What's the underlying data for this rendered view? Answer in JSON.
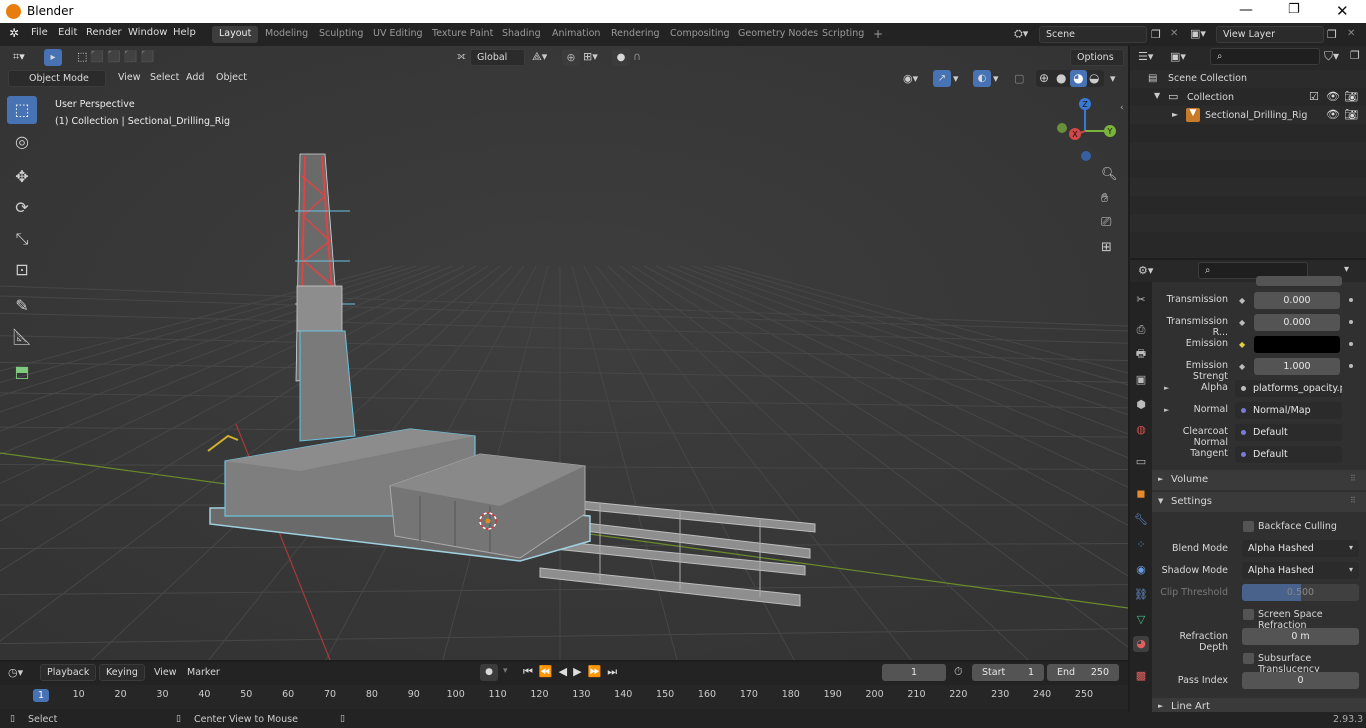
{
  "app": {
    "title": "Blender",
    "version": "2.93.3"
  },
  "menus": [
    "File",
    "Edit",
    "Render",
    "Window",
    "Help"
  ],
  "workspaces": [
    "Layout",
    "Modeling",
    "Sculpting",
    "UV Editing",
    "Texture Paint",
    "Shading",
    "Animation",
    "Rendering",
    "Compositing",
    "Geometry Nodes",
    "Scripting"
  ],
  "active_workspace": "Layout",
  "scene": {
    "name": "Scene",
    "view_layer": "View Layer"
  },
  "viewport": {
    "mode": "Object Mode",
    "menus": [
      "View",
      "Select",
      "Add",
      "Object"
    ],
    "orientation": "Global",
    "options_label": "Options",
    "perspective_label": "User Perspective",
    "collection_label": "(1) Collection | Sectional_Drilling_Rig",
    "axes": {
      "x": "X",
      "y": "Y",
      "z": "Z"
    }
  },
  "outliner": {
    "root": "Scene Collection",
    "collection": "Collection",
    "object": "Sectional_Drilling_Rig"
  },
  "properties": {
    "rows": [
      {
        "label": "Transmission",
        "value": "0.000"
      },
      {
        "label": "Transmission R...",
        "value": "0.000"
      },
      {
        "label": "Emission",
        "value": ""
      },
      {
        "label": "Emission Strengt",
        "value": "1.000"
      },
      {
        "label": "Alpha",
        "value": "platforms_opacity.pn"
      },
      {
        "label": "Normal",
        "value": "Normal/Map"
      },
      {
        "label": "Clearcoat Normal",
        "value": "Default"
      },
      {
        "label": "Tangent",
        "value": "Default"
      }
    ],
    "panels": {
      "volume": "Volume",
      "settings": "Settings",
      "line_art": "Line Art"
    },
    "settings": {
      "backface_culling": "Backface Culling",
      "blend_mode_label": "Blend Mode",
      "blend_mode": "Alpha Hashed",
      "shadow_mode_label": "Shadow Mode",
      "shadow_mode": "Alpha Hashed",
      "clip_threshold_label": "Clip Threshold",
      "clip_threshold": "0.500",
      "ssr": "Screen Space Refraction",
      "refraction_depth_label": "Refraction Depth",
      "refraction_depth": "0 m",
      "subsurface": "Subsurface Translucency",
      "pass_index_label": "Pass Index",
      "pass_index": "0"
    },
    "colors": {
      "emission": "#000000",
      "clip_fill": "#5680c2"
    }
  },
  "timeline": {
    "menus": [
      "Playback",
      "Keying",
      "View",
      "Marker"
    ],
    "current_frame": "1",
    "start_label": "Start",
    "start": "1",
    "end_label": "End",
    "end": "250",
    "ticks": [
      "1",
      "10",
      "20",
      "30",
      "40",
      "50",
      "60",
      "70",
      "80",
      "90",
      "100",
      "110",
      "120",
      "130",
      "140",
      "150",
      "160",
      "170",
      "180",
      "190",
      "200",
      "210",
      "220",
      "230",
      "240",
      "250"
    ]
  },
  "statusbar": {
    "select": "Select",
    "center": "Center View to Mouse"
  }
}
